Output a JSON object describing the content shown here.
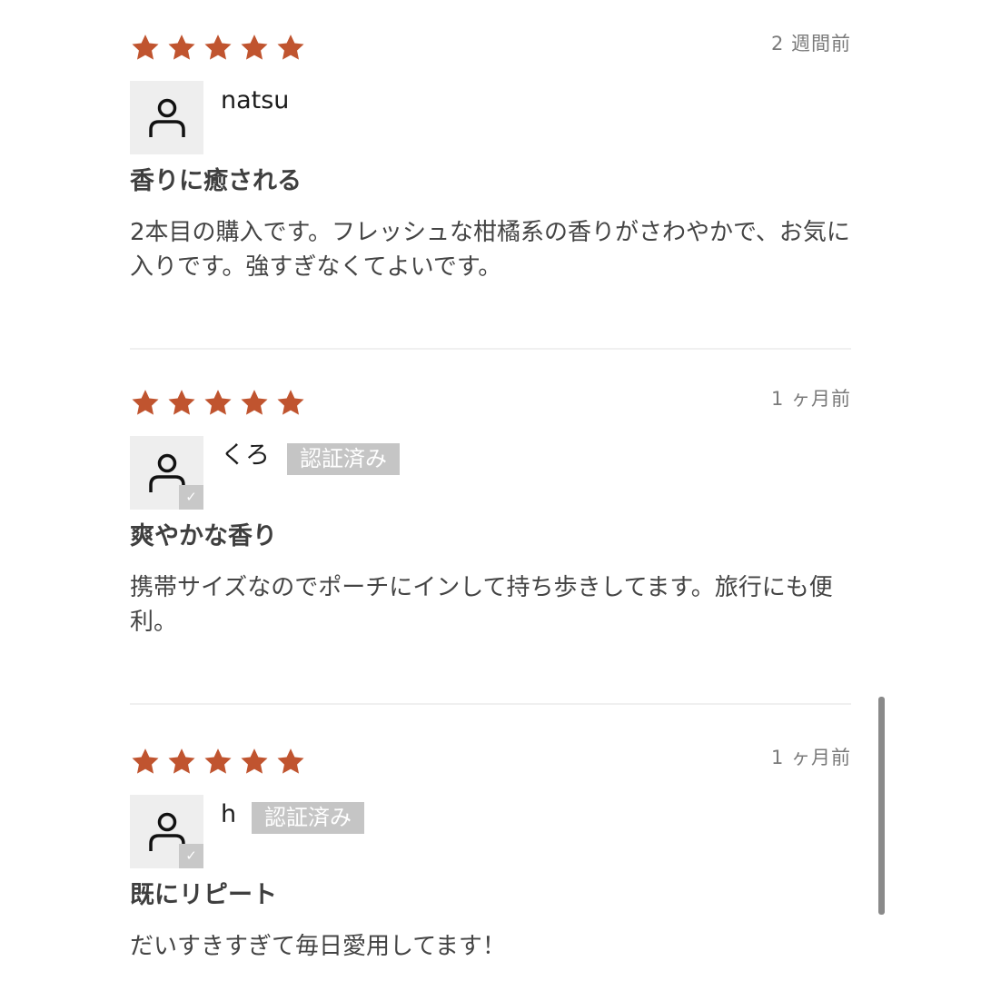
{
  "colors": {
    "star": "#c0542f",
    "badge": "#c5c5c5"
  },
  "reviews": [
    {
      "rating": 5,
      "date": "2 週間前",
      "name": "natsu",
      "verified": false,
      "title": "香りに癒される",
      "body": "2本目の購入です。フレッシュな柑橘系の香りがさわやかで、お気に入りです。強すぎなくてよいです。"
    },
    {
      "rating": 5,
      "date": "1 ヶ月前",
      "name": "くろ",
      "verified": true,
      "badge": "認証済み",
      "title": "爽やかな香り",
      "body": "携帯サイズなのでポーチにインして持ち歩きしてます。旅行にも便利。"
    },
    {
      "rating": 5,
      "date": "1 ヶ月前",
      "name": "h",
      "verified": true,
      "badge": "認証済み",
      "title": "既にリピート",
      "body": "だいすきすぎて毎日愛用してます！"
    }
  ],
  "icons": {
    "star": "star-icon",
    "avatar": "user-icon",
    "check": "checkmark-icon"
  },
  "scroll": {
    "position": 0.85
  }
}
